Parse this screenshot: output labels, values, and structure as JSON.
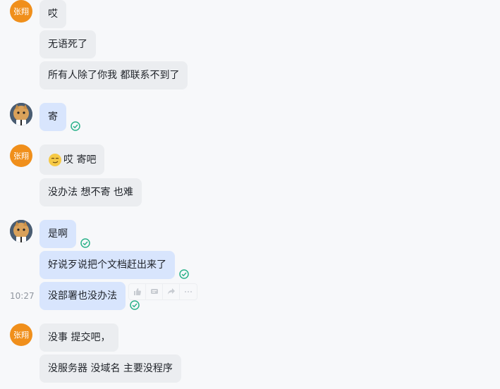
{
  "messages": {
    "g1": {
      "avatar_text": "张翔",
      "m1": "哎",
      "m2": "无语死了",
      "m3": "所有人除了你我 都联系不到了"
    },
    "g2": {
      "m1": "寄"
    },
    "g3": {
      "avatar_text": "张翔",
      "m1": "哎 寄吧",
      "m2": "没办法 想不寄 也难"
    },
    "g4": {
      "m1": "是啊",
      "m2": "好说歹说把个文档赶出来了",
      "m3": "没部署也没办法",
      "time": "10:27"
    },
    "g5": {
      "avatar_text": "张翔",
      "m1": "没事 提交吧，",
      "m2": "没服务器 没域名 主要没程序"
    }
  },
  "colors": {
    "incoming_bubble": "#ebedf0",
    "outgoing_bubble": "#d8e5fd",
    "avatar_orange": "#f08f1b",
    "read_check": "#2bb28a"
  },
  "icons": {
    "hover_actions": [
      "thumbs-up-icon",
      "reply-icon",
      "forward-icon",
      "more-icon"
    ]
  }
}
